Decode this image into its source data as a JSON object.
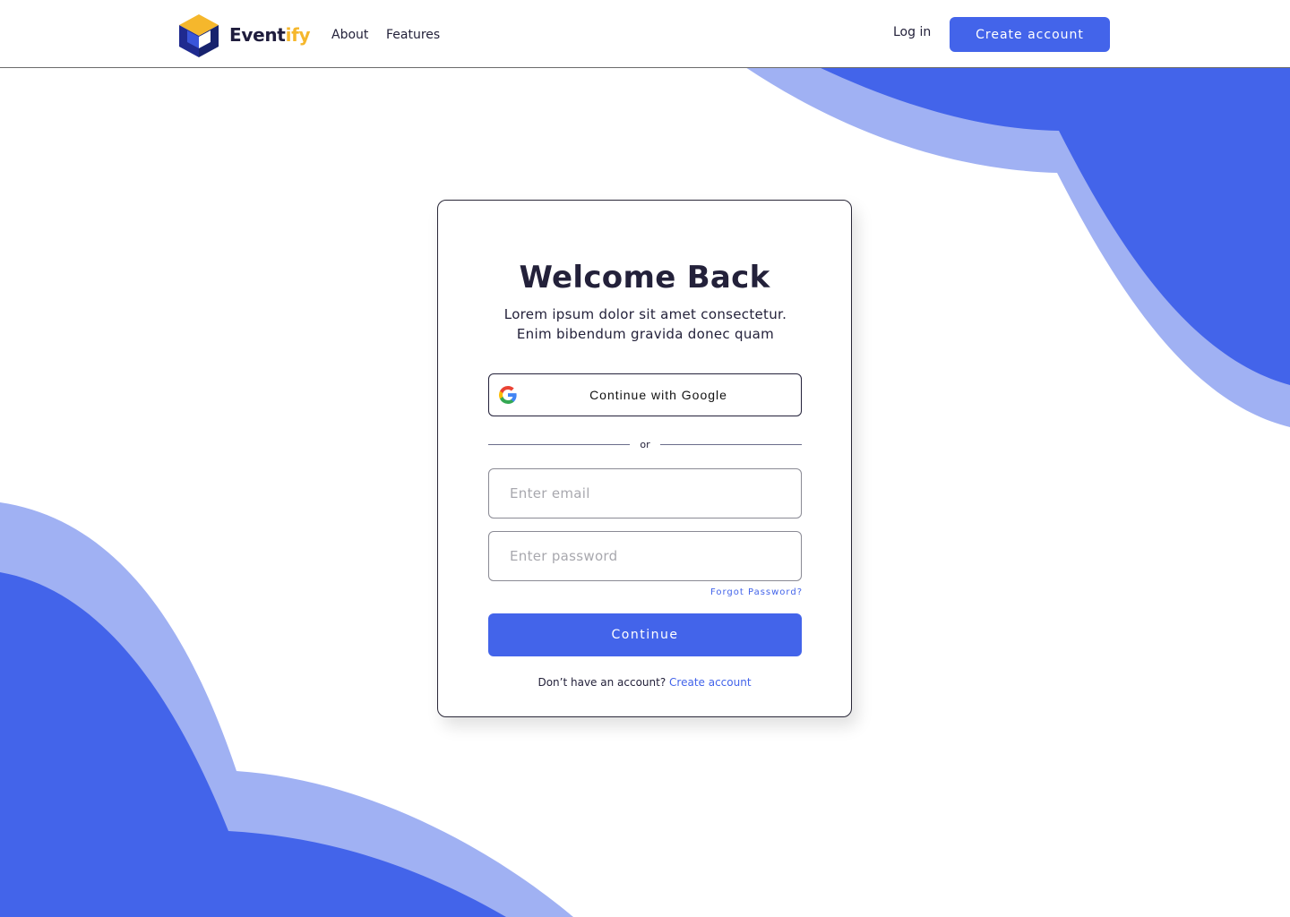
{
  "header": {
    "brand_part1": "Event",
    "brand_part2": "ify",
    "nav": {
      "about": "About",
      "features": "Features"
    },
    "login_label": "Log in",
    "create_account_label": "Create account"
  },
  "card": {
    "title": "Welcome Back",
    "subtitle_line1": "Lorem ipsum dolor sit amet consectetur.",
    "subtitle_line2": "Enim bibendum gravida donec quam",
    "google_label": "Continue with Google",
    "divider_text": "or",
    "email": {
      "value": "",
      "placeholder": "Enter email"
    },
    "password": {
      "value": "",
      "placeholder": "Enter password"
    },
    "forgot_label": "Forgot Password?",
    "continue_label": "Continue",
    "signup_prompt": "Don’t have an account?",
    "signup_link": "Create account"
  },
  "colors": {
    "primary": "#4364ea",
    "primary_light": "#a0b1f3",
    "accent": "#f5b72c",
    "text_dark": "#23213a"
  },
  "icons": {
    "logo": "eventify-cube-logo",
    "google": "google-g-icon"
  }
}
